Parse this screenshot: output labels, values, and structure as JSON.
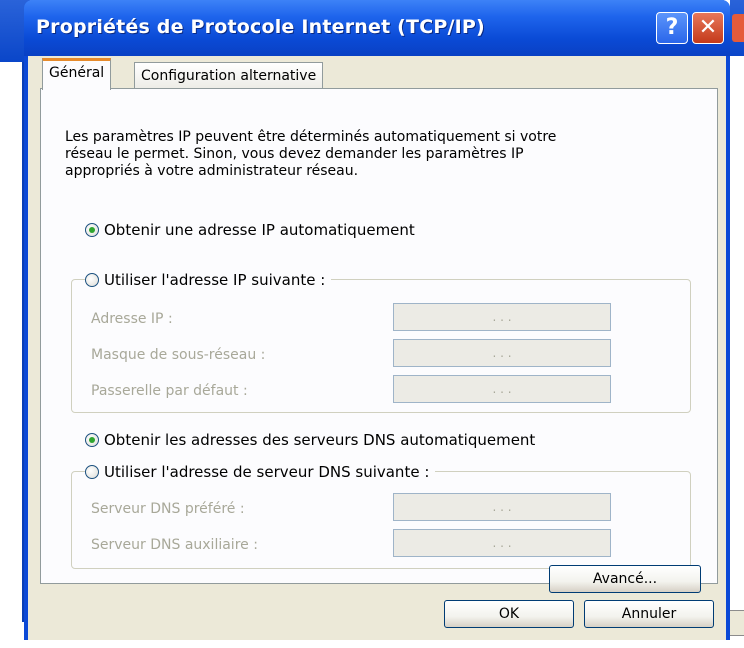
{
  "window": {
    "title": "Propriétés de Protocole Internet (TCP/IP)",
    "help_glyph": "?",
    "close_glyph": "✕"
  },
  "tabs": [
    {
      "label": "Général",
      "active": true
    },
    {
      "label": "Configuration alternative",
      "active": false
    }
  ],
  "intro_lines": [
    "Les paramètres IP peuvent être déterminés automatiquement si votre",
    "réseau le permet. Sinon, vous devez demander les paramètres IP",
    "appropriés à votre administrateur réseau."
  ],
  "ip_options": {
    "auto_label": "Obtenir une adresse IP automatiquement",
    "auto_checked": true,
    "manual_label": "Utiliser l'adresse IP suivante :",
    "manual_checked": false,
    "fields": [
      {
        "label": "Adresse IP :",
        "value": ". . ."
      },
      {
        "label": "Masque de sous-réseau :",
        "value": ". . ."
      },
      {
        "label": "Passerelle par défaut :",
        "value": ". . ."
      }
    ]
  },
  "dns_options": {
    "auto_label": "Obtenir les adresses des serveurs DNS automatiquement",
    "auto_checked": true,
    "manual_label": "Utiliser l'adresse de serveur DNS suivante :",
    "manual_checked": false,
    "fields": [
      {
        "label": "Serveur DNS préféré :",
        "value": ". . ."
      },
      {
        "label": "Serveur DNS auxiliaire :",
        "value": ". . ."
      }
    ]
  },
  "buttons": {
    "advanced": "Avancé...",
    "ok": "OK",
    "cancel": "Annuler"
  },
  "colors": {
    "titlebar": "#0a4ad5",
    "face": "#ece9d8",
    "active_tab_accent": "#e68b2c",
    "disabled_text": "#a8a899",
    "radio_dot": "#2fa52f"
  }
}
